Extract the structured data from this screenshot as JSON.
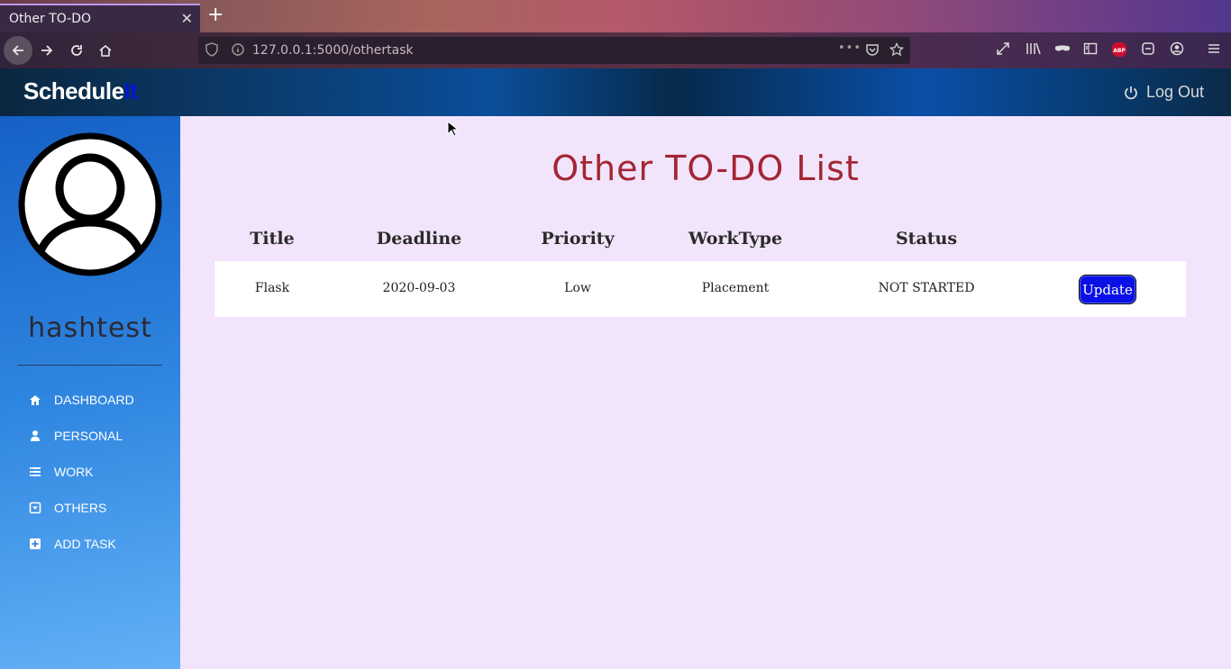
{
  "browser": {
    "tab_title": "Other TO-DO",
    "tab_close": "✕",
    "new_tab": "+",
    "url": "127.0.0.1:5000/othertask",
    "url_more": "•••"
  },
  "header": {
    "brand_main": "Schedule",
    "brand_accent": "It",
    "logout_label": "Log Out"
  },
  "sidebar": {
    "username": "hashtest",
    "items": [
      {
        "label": "DASHBOARD",
        "icon": "home-icon"
      },
      {
        "label": "PERSONAL",
        "icon": "user-icon"
      },
      {
        "label": "WORK",
        "icon": "list-icon"
      },
      {
        "label": "OTHERS",
        "icon": "caret-box-icon"
      },
      {
        "label": "ADD TASK",
        "icon": "plus-square-icon"
      }
    ]
  },
  "main": {
    "title": "Other TO-DO List",
    "columns": [
      "Title",
      "Deadline",
      "Priority",
      "WorkType",
      "Status"
    ],
    "rows": [
      {
        "title": "Flask",
        "deadline": "2020-09-03",
        "priority": "Low",
        "worktype": "Placement",
        "status": "NOT STARTED",
        "action": "Update"
      }
    ]
  },
  "colors": {
    "title": "#a32634",
    "button": "#0a10e6",
    "background": "#f2e4fb",
    "brand_accent": "#0018d8"
  }
}
